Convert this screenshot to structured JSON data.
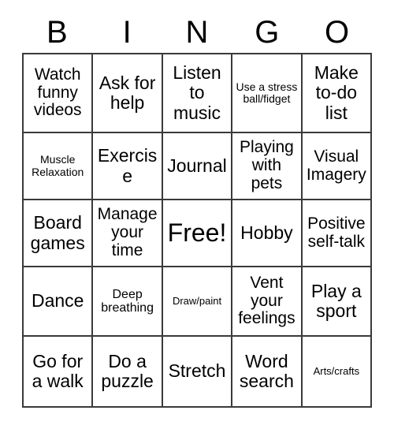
{
  "card": {
    "title": "BINGO",
    "headers": [
      "B",
      "I",
      "N",
      "G",
      "O"
    ],
    "rows": [
      [
        {
          "text": "Watch funny videos",
          "size": "md"
        },
        {
          "text": "Ask for help",
          "size": "lg"
        },
        {
          "text": "Listen to music",
          "size": "lg"
        },
        {
          "text": "Use a stress ball/fidget",
          "size": "xs"
        },
        {
          "text": "Make to-do list",
          "size": "lg"
        }
      ],
      [
        {
          "text": "Muscle Relaxation",
          "size": "xs"
        },
        {
          "text": "Exercise",
          "size": "lg"
        },
        {
          "text": "Journal",
          "size": "lg"
        },
        {
          "text": "Playing with pets",
          "size": "md"
        },
        {
          "text": "Visual Imagery",
          "size": "md"
        }
      ],
      [
        {
          "text": "Board games",
          "size": "lg"
        },
        {
          "text": "Manage your time",
          "size": "md"
        },
        {
          "text": "Free!",
          "size": "xl"
        },
        {
          "text": "Hobby",
          "size": "lg"
        },
        {
          "text": "Positive self-talk",
          "size": "md"
        }
      ],
      [
        {
          "text": "Dance",
          "size": "lg"
        },
        {
          "text": "Deep breathing",
          "size": "sm"
        },
        {
          "text": "Draw/paint",
          "size": "xxs"
        },
        {
          "text": "Vent your feelings",
          "size": "md"
        },
        {
          "text": "Play a sport",
          "size": "lg"
        }
      ],
      [
        {
          "text": "Go for a walk",
          "size": "lg"
        },
        {
          "text": "Do a puzzle",
          "size": "lg"
        },
        {
          "text": "Stretch",
          "size": "lg"
        },
        {
          "text": "Word search",
          "size": "lg"
        },
        {
          "text": "Arts/crafts",
          "size": "xxs"
        }
      ]
    ],
    "free_space": {
      "row": 2,
      "column": 2,
      "label": "Free!"
    },
    "colors": {
      "background": "#ffffff",
      "text": "#000000",
      "border": "#3a3a3a"
    }
  }
}
